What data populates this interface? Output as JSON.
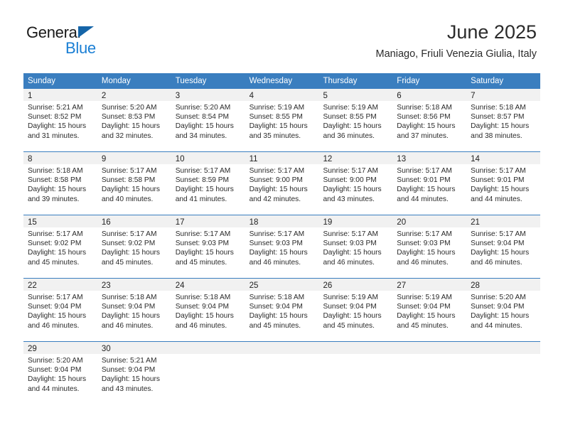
{
  "brand": {
    "name_top": "General",
    "name_bottom": "Blue",
    "triangle_icon": "brand-triangle-icon",
    "color_dark": "#1a1a1a",
    "color_blue": "#1a7fd4"
  },
  "header": {
    "title": "June 2025",
    "subtitle": "Maniago, Friuli Venezia Giulia, Italy"
  },
  "theme": {
    "header_bg": "#3a7ebf",
    "header_text": "#ffffff",
    "daynum_bg": "#f1f1f1",
    "cell_bg": "#ffffff",
    "grid_line": "#3a7ebf"
  },
  "calendar": {
    "weekday_headers": [
      "Sunday",
      "Monday",
      "Tuesday",
      "Wednesday",
      "Thursday",
      "Friday",
      "Saturday"
    ],
    "weeks": [
      [
        {
          "day": "1",
          "sunrise": "Sunrise: 5:21 AM",
          "sunset": "Sunset: 8:52 PM",
          "daylight1": "Daylight: 15 hours",
          "daylight2": "and 31 minutes."
        },
        {
          "day": "2",
          "sunrise": "Sunrise: 5:20 AM",
          "sunset": "Sunset: 8:53 PM",
          "daylight1": "Daylight: 15 hours",
          "daylight2": "and 32 minutes."
        },
        {
          "day": "3",
          "sunrise": "Sunrise: 5:20 AM",
          "sunset": "Sunset: 8:54 PM",
          "daylight1": "Daylight: 15 hours",
          "daylight2": "and 34 minutes."
        },
        {
          "day": "4",
          "sunrise": "Sunrise: 5:19 AM",
          "sunset": "Sunset: 8:55 PM",
          "daylight1": "Daylight: 15 hours",
          "daylight2": "and 35 minutes."
        },
        {
          "day": "5",
          "sunrise": "Sunrise: 5:19 AM",
          "sunset": "Sunset: 8:55 PM",
          "daylight1": "Daylight: 15 hours",
          "daylight2": "and 36 minutes."
        },
        {
          "day": "6",
          "sunrise": "Sunrise: 5:18 AM",
          "sunset": "Sunset: 8:56 PM",
          "daylight1": "Daylight: 15 hours",
          "daylight2": "and 37 minutes."
        },
        {
          "day": "7",
          "sunrise": "Sunrise: 5:18 AM",
          "sunset": "Sunset: 8:57 PM",
          "daylight1": "Daylight: 15 hours",
          "daylight2": "and 38 minutes."
        }
      ],
      [
        {
          "day": "8",
          "sunrise": "Sunrise: 5:18 AM",
          "sunset": "Sunset: 8:58 PM",
          "daylight1": "Daylight: 15 hours",
          "daylight2": "and 39 minutes."
        },
        {
          "day": "9",
          "sunrise": "Sunrise: 5:17 AM",
          "sunset": "Sunset: 8:58 PM",
          "daylight1": "Daylight: 15 hours",
          "daylight2": "and 40 minutes."
        },
        {
          "day": "10",
          "sunrise": "Sunrise: 5:17 AM",
          "sunset": "Sunset: 8:59 PM",
          "daylight1": "Daylight: 15 hours",
          "daylight2": "and 41 minutes."
        },
        {
          "day": "11",
          "sunrise": "Sunrise: 5:17 AM",
          "sunset": "Sunset: 9:00 PM",
          "daylight1": "Daylight: 15 hours",
          "daylight2": "and 42 minutes."
        },
        {
          "day": "12",
          "sunrise": "Sunrise: 5:17 AM",
          "sunset": "Sunset: 9:00 PM",
          "daylight1": "Daylight: 15 hours",
          "daylight2": "and 43 minutes."
        },
        {
          "day": "13",
          "sunrise": "Sunrise: 5:17 AM",
          "sunset": "Sunset: 9:01 PM",
          "daylight1": "Daylight: 15 hours",
          "daylight2": "and 44 minutes."
        },
        {
          "day": "14",
          "sunrise": "Sunrise: 5:17 AM",
          "sunset": "Sunset: 9:01 PM",
          "daylight1": "Daylight: 15 hours",
          "daylight2": "and 44 minutes."
        }
      ],
      [
        {
          "day": "15",
          "sunrise": "Sunrise: 5:17 AM",
          "sunset": "Sunset: 9:02 PM",
          "daylight1": "Daylight: 15 hours",
          "daylight2": "and 45 minutes."
        },
        {
          "day": "16",
          "sunrise": "Sunrise: 5:17 AM",
          "sunset": "Sunset: 9:02 PM",
          "daylight1": "Daylight: 15 hours",
          "daylight2": "and 45 minutes."
        },
        {
          "day": "17",
          "sunrise": "Sunrise: 5:17 AM",
          "sunset": "Sunset: 9:03 PM",
          "daylight1": "Daylight: 15 hours",
          "daylight2": "and 45 minutes."
        },
        {
          "day": "18",
          "sunrise": "Sunrise: 5:17 AM",
          "sunset": "Sunset: 9:03 PM",
          "daylight1": "Daylight: 15 hours",
          "daylight2": "and 46 minutes."
        },
        {
          "day": "19",
          "sunrise": "Sunrise: 5:17 AM",
          "sunset": "Sunset: 9:03 PM",
          "daylight1": "Daylight: 15 hours",
          "daylight2": "and 46 minutes."
        },
        {
          "day": "20",
          "sunrise": "Sunrise: 5:17 AM",
          "sunset": "Sunset: 9:03 PM",
          "daylight1": "Daylight: 15 hours",
          "daylight2": "and 46 minutes."
        },
        {
          "day": "21",
          "sunrise": "Sunrise: 5:17 AM",
          "sunset": "Sunset: 9:04 PM",
          "daylight1": "Daylight: 15 hours",
          "daylight2": "and 46 minutes."
        }
      ],
      [
        {
          "day": "22",
          "sunrise": "Sunrise: 5:17 AM",
          "sunset": "Sunset: 9:04 PM",
          "daylight1": "Daylight: 15 hours",
          "daylight2": "and 46 minutes."
        },
        {
          "day": "23",
          "sunrise": "Sunrise: 5:18 AM",
          "sunset": "Sunset: 9:04 PM",
          "daylight1": "Daylight: 15 hours",
          "daylight2": "and 46 minutes."
        },
        {
          "day": "24",
          "sunrise": "Sunrise: 5:18 AM",
          "sunset": "Sunset: 9:04 PM",
          "daylight1": "Daylight: 15 hours",
          "daylight2": "and 46 minutes."
        },
        {
          "day": "25",
          "sunrise": "Sunrise: 5:18 AM",
          "sunset": "Sunset: 9:04 PM",
          "daylight1": "Daylight: 15 hours",
          "daylight2": "and 45 minutes."
        },
        {
          "day": "26",
          "sunrise": "Sunrise: 5:19 AM",
          "sunset": "Sunset: 9:04 PM",
          "daylight1": "Daylight: 15 hours",
          "daylight2": "and 45 minutes."
        },
        {
          "day": "27",
          "sunrise": "Sunrise: 5:19 AM",
          "sunset": "Sunset: 9:04 PM",
          "daylight1": "Daylight: 15 hours",
          "daylight2": "and 45 minutes."
        },
        {
          "day": "28",
          "sunrise": "Sunrise: 5:20 AM",
          "sunset": "Sunset: 9:04 PM",
          "daylight1": "Daylight: 15 hours",
          "daylight2": "and 44 minutes."
        }
      ],
      [
        {
          "day": "29",
          "sunrise": "Sunrise: 5:20 AM",
          "sunset": "Sunset: 9:04 PM",
          "daylight1": "Daylight: 15 hours",
          "daylight2": "and 44 minutes."
        },
        {
          "day": "30",
          "sunrise": "Sunrise: 5:21 AM",
          "sunset": "Sunset: 9:04 PM",
          "daylight1": "Daylight: 15 hours",
          "daylight2": "and 43 minutes."
        },
        {
          "day": "",
          "sunrise": "",
          "sunset": "",
          "daylight1": "",
          "daylight2": ""
        },
        {
          "day": "",
          "sunrise": "",
          "sunset": "",
          "daylight1": "",
          "daylight2": ""
        },
        {
          "day": "",
          "sunrise": "",
          "sunset": "",
          "daylight1": "",
          "daylight2": ""
        },
        {
          "day": "",
          "sunrise": "",
          "sunset": "",
          "daylight1": "",
          "daylight2": ""
        },
        {
          "day": "",
          "sunrise": "",
          "sunset": "",
          "daylight1": "",
          "daylight2": ""
        }
      ]
    ]
  }
}
